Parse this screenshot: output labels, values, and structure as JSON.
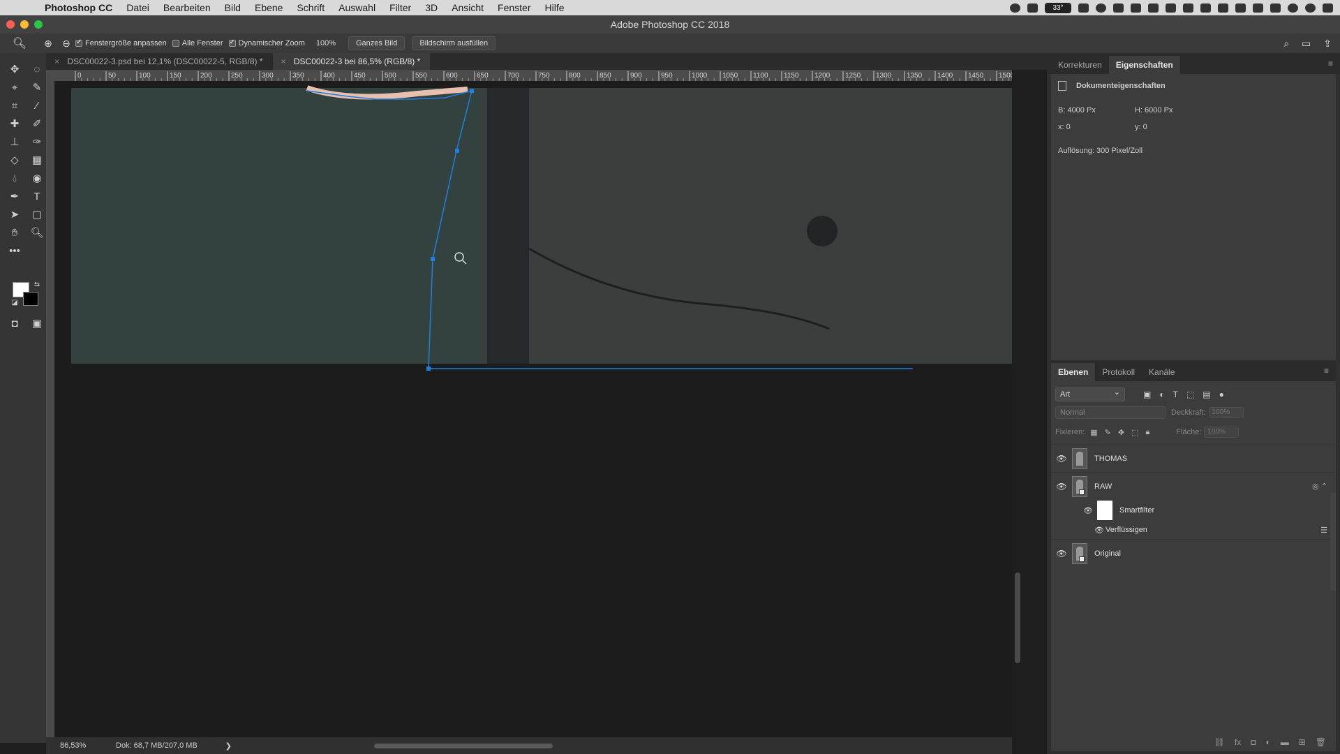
{
  "menubar": {
    "apple_icon": "",
    "items": [
      "Photoshop CC",
      "Datei",
      "Bearbeiten",
      "Bild",
      "Ebene",
      "Schrift",
      "Auswahl",
      "Filter",
      "3D",
      "Ansicht",
      "Fenster",
      "Hilfe"
    ],
    "temperature": "33°"
  },
  "window": {
    "title": "Adobe Photoshop CC 2018"
  },
  "options": {
    "fit_window_label": "Fenstergröße anpassen",
    "all_windows_label": "Alle Fenster",
    "dynamic_zoom_label": "Dynamischer Zoom",
    "zoom_value": "100%",
    "fit_screen_button": "Ganzes Bild",
    "fill_screen_button": "Bildschirm ausfüllen"
  },
  "tabs": [
    {
      "label": "DSC00022-3.psd bei 12,1% (DSC00022-5, RGB/8) *"
    },
    {
      "label": "DSC00022-3 bei 86,5% (RGB/8) *"
    }
  ],
  "ruler": {
    "ticks": [
      "0",
      "50",
      "100",
      "150",
      "200",
      "250",
      "300",
      "350",
      "400",
      "450",
      "500",
      "550",
      "600",
      "650",
      "700",
      "750",
      "800",
      "850",
      "900",
      "950",
      "1000",
      "1050",
      "1100",
      "1150",
      "1200",
      "1250",
      "1300",
      "1350",
      "1400",
      "1450",
      "1500"
    ]
  },
  "status": {
    "zoom": "86,53%",
    "doc": "Dok: 68,7 MB/207,0 MB",
    "arrow": "❯"
  },
  "properties": {
    "tabs": [
      "Korrekturen",
      "Eigenschaften"
    ],
    "header": "Dokumenteigenschaften",
    "width": "B:  4000 Px",
    "height": "H:  6000 Px",
    "x": "x:  0",
    "y": "y:  0",
    "resolution": "Auflösung: 300 Pixel/Zoll"
  },
  "layers": {
    "tabs": [
      "Ebenen",
      "Protokoll",
      "Kanäle"
    ],
    "filter": "Art",
    "blend_mode": "Normal",
    "opacity_label": "Deckkraft:",
    "opacity_value": "100%",
    "lock_label": "Fixieren:",
    "fill_label": "Fläche:",
    "fill_value": "100%",
    "items": [
      {
        "name": "THOMAS"
      },
      {
        "name": "RAW"
      },
      {
        "name": "Smartfilter"
      },
      {
        "name": "Verflüssigen"
      },
      {
        "name": "Original"
      }
    ]
  },
  "colors": {
    "accent": "#1f7fe0",
    "fabric": "#33423f",
    "leather": "#3a3f3e"
  }
}
